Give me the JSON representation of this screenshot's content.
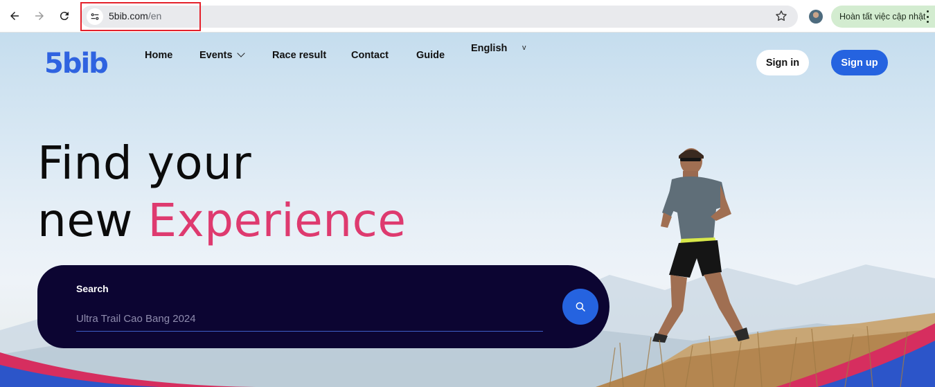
{
  "browser": {
    "url_domain": "5bib.com",
    "url_path": "/en",
    "update_label": "Hoàn tất việc cập nhật",
    "icons": [
      "back-icon",
      "forward-icon",
      "reload-icon",
      "site-info-icon",
      "star-icon",
      "profile-avatar",
      "more-icon"
    ]
  },
  "site": {
    "logo_text": "5bib",
    "nav": {
      "home": "Home",
      "events": "Events",
      "race_result": "Race result",
      "contact": "Contact",
      "guide": "Guide",
      "language": "English",
      "language_caret": "v"
    },
    "sign_in": "Sign in",
    "sign_up": "Sign up"
  },
  "hero": {
    "line1": "Find your",
    "line2_prefix": "new ",
    "line2_accent": "Experience"
  },
  "search": {
    "label": "Search",
    "placeholder": "Ultra Trail Cao Bang 2024"
  },
  "colors": {
    "brand_blue": "#2563e0",
    "accent_pink": "#de3a6f",
    "search_bg": "#0c0532",
    "highlight_red": "#e4202a"
  }
}
